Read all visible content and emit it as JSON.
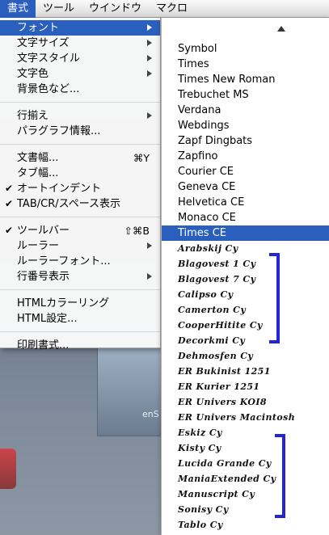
{
  "menubar": {
    "items": [
      {
        "label": "書式",
        "active": true
      },
      {
        "label": "ツール",
        "active": false
      },
      {
        "label": "ウインドウ",
        "active": false
      },
      {
        "label": "マクロ",
        "active": false
      }
    ]
  },
  "menu": {
    "items": [
      {
        "label": "フォント",
        "submenu": true,
        "highlight": true
      },
      {
        "label": "文字サイズ",
        "submenu": true
      },
      {
        "label": "文字スタイル",
        "submenu": true
      },
      {
        "label": "文字色",
        "submenu": true
      },
      {
        "label": "背景色など..."
      },
      {
        "separator": true
      },
      {
        "label": "行揃え",
        "submenu": true
      },
      {
        "label": "パラグラフ情報..."
      },
      {
        "separator": true
      },
      {
        "label": "文書幅...",
        "shortcut": "⌘Y"
      },
      {
        "label": "タブ幅..."
      },
      {
        "label": "オートインデント",
        "checked": true
      },
      {
        "label": "TAB/CR/スペース表示",
        "checked": true
      },
      {
        "separator": true
      },
      {
        "label": "ツールバー",
        "checked": true,
        "shortcut": "⇧⌘B"
      },
      {
        "label": "ルーラー",
        "submenu": true
      },
      {
        "label": "ルーラーフォント..."
      },
      {
        "label": "行番号表示",
        "submenu": true
      },
      {
        "separator": true
      },
      {
        "label": "HTMLカラーリング"
      },
      {
        "label": "HTML設定..."
      },
      {
        "separator": true
      },
      {
        "label": "印刷書式..."
      }
    ]
  },
  "submenu": {
    "fonts": [
      {
        "label": "Symbol"
      },
      {
        "label": "Times"
      },
      {
        "label": "Times New Roman"
      },
      {
        "label": "Trebuchet MS"
      },
      {
        "label": "Verdana"
      },
      {
        "label": "Webdings"
      },
      {
        "label": "Zapf Dingbats"
      },
      {
        "label": "Zapfino"
      },
      {
        "label": "Courier CE"
      },
      {
        "label": "Geneva CE"
      },
      {
        "label": "Helvetica CE"
      },
      {
        "label": "Monaco CE"
      },
      {
        "label": "Times CE",
        "highlight": true
      },
      {
        "label": "Arabskij Cy",
        "special": true
      },
      {
        "label": "Blagovest 1 Cy",
        "special": true
      },
      {
        "label": "Blagovest 7 Cy",
        "special": true
      },
      {
        "label": "Calipso Cy",
        "special": true
      },
      {
        "label": "Camerton Cy",
        "special": true
      },
      {
        "label": "CooperHitite Cy",
        "special": true
      },
      {
        "label": "Decorkmi Cy",
        "special": true
      },
      {
        "label": "Dehmosfen Cy",
        "special": true
      },
      {
        "label": "ER Bukinist 1251",
        "special": true
      },
      {
        "label": "ER Kurier 1251",
        "special": true
      },
      {
        "label": "ER Univers KOI8",
        "special": true
      },
      {
        "label": "ER Univers Macintosh",
        "special": true
      },
      {
        "label": "Eskiz Cy",
        "special": true
      },
      {
        "label": "Kisty Cy",
        "special": true
      },
      {
        "label": "Lucida Grande Cy",
        "special": true
      },
      {
        "label": "ManiaExtended Cy",
        "special": true
      },
      {
        "label": "Manuscript Cy",
        "special": true
      },
      {
        "label": "Sonisy Cy",
        "special": true
      },
      {
        "label": "Tablo Cy",
        "special": true
      }
    ]
  },
  "desktop": {
    "window_label": "enS"
  },
  "colors": {
    "highlight": "#2b5fbd",
    "bracket": "#2424d9"
  }
}
